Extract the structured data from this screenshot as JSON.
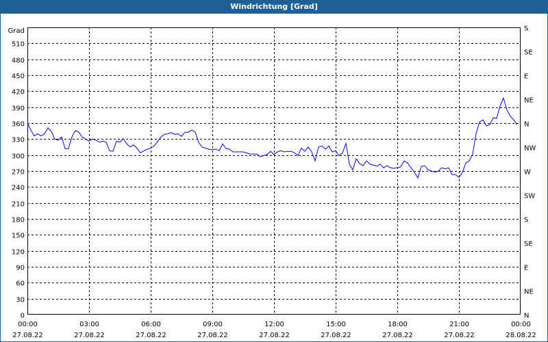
{
  "window": {
    "title": "Windrichtung [Grad]"
  },
  "chart_data": {
    "type": "line",
    "title": "Windrichtung [Grad]",
    "ylabel": "Grad",
    "ylim": [
      0,
      540
    ],
    "yticks": [
      0,
      30,
      60,
      90,
      120,
      150,
      180,
      210,
      240,
      270,
      300,
      330,
      360,
      390,
      420,
      450,
      480,
      510
    ],
    "y2ticks": [
      {
        "value": 0,
        "label": "N"
      },
      {
        "value": 45,
        "label": "NE"
      },
      {
        "value": 90,
        "label": "E"
      },
      {
        "value": 135,
        "label": "SE"
      },
      {
        "value": 180,
        "label": "S"
      },
      {
        "value": 225,
        "label": "SW"
      },
      {
        "value": 270,
        "label": "W"
      },
      {
        "value": 315,
        "label": "NW"
      },
      {
        "value": 360,
        "label": "N"
      },
      {
        "value": 405,
        "label": "NE"
      },
      {
        "value": 450,
        "label": "E"
      },
      {
        "value": 495,
        "label": "SE"
      },
      {
        "value": 540,
        "label": "S"
      }
    ],
    "xlim_hours": [
      0,
      24
    ],
    "xticks": [
      {
        "hour": 0,
        "time": "00:00",
        "date": "27.08.22"
      },
      {
        "hour": 3,
        "time": "03:00",
        "date": "27.08.22"
      },
      {
        "hour": 6,
        "time": "06:00",
        "date": "27.08.22"
      },
      {
        "hour": 9,
        "time": "09:00",
        "date": "27.08.22"
      },
      {
        "hour": 12,
        "time": "12:00",
        "date": "27.08.22"
      },
      {
        "hour": 15,
        "time": "15:00",
        "date": "27.08.22"
      },
      {
        "hour": 18,
        "time": "18:00",
        "date": "27.08.22"
      },
      {
        "hour": 21,
        "time": "21:00",
        "date": "27.08.22"
      },
      {
        "hour": 24,
        "time": "00:00",
        "date": "28.08.22"
      }
    ],
    "grid": true,
    "series": [
      {
        "name": "Windrichtung",
        "color": "#0000ff",
        "interval_minutes": 10,
        "values": [
          360,
          347,
          336,
          340,
          336,
          340,
          351,
          344,
          330,
          328,
          334,
          312,
          312,
          334,
          346,
          343,
          334,
          330,
          326,
          330,
          328,
          324,
          326,
          324,
          308,
          307,
          326,
          324,
          331,
          321,
          315,
          319,
          313,
          304,
          308,
          311,
          313,
          317,
          325,
          334,
          339,
          340,
          342,
          339,
          340,
          335,
          343,
          343,
          347,
          343,
          324,
          315,
          313,
          311,
          310,
          311,
          308,
          321,
          312,
          311,
          306,
          306,
          306,
          306,
          304,
          302,
          302,
          302,
          297,
          299,
          301,
          307,
          301,
          306,
          308,
          306,
          307,
          307,
          304,
          299,
          313,
          307,
          315,
          306,
          289,
          315,
          317,
          311,
          317,
          306,
          308,
          299,
          304,
          322,
          283,
          272,
          293,
          284,
          280,
          289,
          283,
          281,
          279,
          283,
          276,
          280,
          276,
          275,
          276,
          278,
          289,
          285,
          276,
          268,
          257,
          278,
          280,
          272,
          270,
          268,
          270,
          276,
          274,
          276,
          263,
          263,
          258,
          267,
          285,
          289,
          302,
          340,
          362,
          366,
          355,
          357,
          370,
          369,
          392,
          407,
          385,
          373,
          366,
          357
        ]
      }
    ]
  }
}
